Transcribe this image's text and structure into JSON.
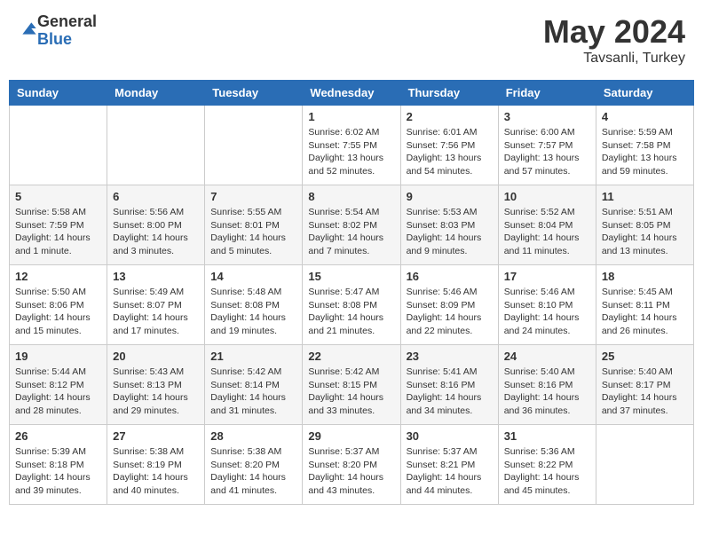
{
  "header": {
    "logo_general": "General",
    "logo_blue": "Blue",
    "month": "May 2024",
    "location": "Tavsanli, Turkey"
  },
  "weekdays": [
    "Sunday",
    "Monday",
    "Tuesday",
    "Wednesday",
    "Thursday",
    "Friday",
    "Saturday"
  ],
  "weeks": [
    [
      {
        "day": "",
        "info": ""
      },
      {
        "day": "",
        "info": ""
      },
      {
        "day": "",
        "info": ""
      },
      {
        "day": "1",
        "info": "Sunrise: 6:02 AM\nSunset: 7:55 PM\nDaylight: 13 hours\nand 52 minutes."
      },
      {
        "day": "2",
        "info": "Sunrise: 6:01 AM\nSunset: 7:56 PM\nDaylight: 13 hours\nand 54 minutes."
      },
      {
        "day": "3",
        "info": "Sunrise: 6:00 AM\nSunset: 7:57 PM\nDaylight: 13 hours\nand 57 minutes."
      },
      {
        "day": "4",
        "info": "Sunrise: 5:59 AM\nSunset: 7:58 PM\nDaylight: 13 hours\nand 59 minutes."
      }
    ],
    [
      {
        "day": "5",
        "info": "Sunrise: 5:58 AM\nSunset: 7:59 PM\nDaylight: 14 hours\nand 1 minute."
      },
      {
        "day": "6",
        "info": "Sunrise: 5:56 AM\nSunset: 8:00 PM\nDaylight: 14 hours\nand 3 minutes."
      },
      {
        "day": "7",
        "info": "Sunrise: 5:55 AM\nSunset: 8:01 PM\nDaylight: 14 hours\nand 5 minutes."
      },
      {
        "day": "8",
        "info": "Sunrise: 5:54 AM\nSunset: 8:02 PM\nDaylight: 14 hours\nand 7 minutes."
      },
      {
        "day": "9",
        "info": "Sunrise: 5:53 AM\nSunset: 8:03 PM\nDaylight: 14 hours\nand 9 minutes."
      },
      {
        "day": "10",
        "info": "Sunrise: 5:52 AM\nSunset: 8:04 PM\nDaylight: 14 hours\nand 11 minutes."
      },
      {
        "day": "11",
        "info": "Sunrise: 5:51 AM\nSunset: 8:05 PM\nDaylight: 14 hours\nand 13 minutes."
      }
    ],
    [
      {
        "day": "12",
        "info": "Sunrise: 5:50 AM\nSunset: 8:06 PM\nDaylight: 14 hours\nand 15 minutes."
      },
      {
        "day": "13",
        "info": "Sunrise: 5:49 AM\nSunset: 8:07 PM\nDaylight: 14 hours\nand 17 minutes."
      },
      {
        "day": "14",
        "info": "Sunrise: 5:48 AM\nSunset: 8:08 PM\nDaylight: 14 hours\nand 19 minutes."
      },
      {
        "day": "15",
        "info": "Sunrise: 5:47 AM\nSunset: 8:08 PM\nDaylight: 14 hours\nand 21 minutes."
      },
      {
        "day": "16",
        "info": "Sunrise: 5:46 AM\nSunset: 8:09 PM\nDaylight: 14 hours\nand 22 minutes."
      },
      {
        "day": "17",
        "info": "Sunrise: 5:46 AM\nSunset: 8:10 PM\nDaylight: 14 hours\nand 24 minutes."
      },
      {
        "day": "18",
        "info": "Sunrise: 5:45 AM\nSunset: 8:11 PM\nDaylight: 14 hours\nand 26 minutes."
      }
    ],
    [
      {
        "day": "19",
        "info": "Sunrise: 5:44 AM\nSunset: 8:12 PM\nDaylight: 14 hours\nand 28 minutes."
      },
      {
        "day": "20",
        "info": "Sunrise: 5:43 AM\nSunset: 8:13 PM\nDaylight: 14 hours\nand 29 minutes."
      },
      {
        "day": "21",
        "info": "Sunrise: 5:42 AM\nSunset: 8:14 PM\nDaylight: 14 hours\nand 31 minutes."
      },
      {
        "day": "22",
        "info": "Sunrise: 5:42 AM\nSunset: 8:15 PM\nDaylight: 14 hours\nand 33 minutes."
      },
      {
        "day": "23",
        "info": "Sunrise: 5:41 AM\nSunset: 8:16 PM\nDaylight: 14 hours\nand 34 minutes."
      },
      {
        "day": "24",
        "info": "Sunrise: 5:40 AM\nSunset: 8:16 PM\nDaylight: 14 hours\nand 36 minutes."
      },
      {
        "day": "25",
        "info": "Sunrise: 5:40 AM\nSunset: 8:17 PM\nDaylight: 14 hours\nand 37 minutes."
      }
    ],
    [
      {
        "day": "26",
        "info": "Sunrise: 5:39 AM\nSunset: 8:18 PM\nDaylight: 14 hours\nand 39 minutes."
      },
      {
        "day": "27",
        "info": "Sunrise: 5:38 AM\nSunset: 8:19 PM\nDaylight: 14 hours\nand 40 minutes."
      },
      {
        "day": "28",
        "info": "Sunrise: 5:38 AM\nSunset: 8:20 PM\nDaylight: 14 hours\nand 41 minutes."
      },
      {
        "day": "29",
        "info": "Sunrise: 5:37 AM\nSunset: 8:20 PM\nDaylight: 14 hours\nand 43 minutes."
      },
      {
        "day": "30",
        "info": "Sunrise: 5:37 AM\nSunset: 8:21 PM\nDaylight: 14 hours\nand 44 minutes."
      },
      {
        "day": "31",
        "info": "Sunrise: 5:36 AM\nSunset: 8:22 PM\nDaylight: 14 hours\nand 45 minutes."
      },
      {
        "day": "",
        "info": ""
      }
    ]
  ]
}
